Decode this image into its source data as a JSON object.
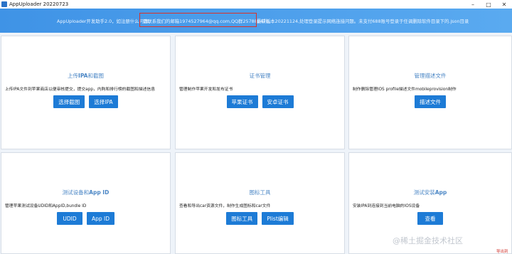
{
  "window": {
    "title": "AppUploader 20220723"
  },
  "banner": {
    "text_left": "AppUploader开发助手2.0，如注册什么问题，",
    "text_highlight": "请联系我们的邮箱1974527964@qq.com,QQ群257889476。",
    "text_right": "最新版本20221124,处理登录提示网络连接问题。未支付688账号登录于任调删除软件目录下的.json目录"
  },
  "cards": [
    {
      "title_pre": "上传",
      "title_bold": "IPA",
      "title_post": "和截图",
      "desc": "上传IPA文件到苹果商店以便审核提交，提交app，内购和排行榜的截图和描述信息",
      "buttons": [
        "选择截图",
        "选择IPA"
      ]
    },
    {
      "title_pre": "证书管理",
      "title_bold": "",
      "title_post": "",
      "desc": "管理制作苹果开发和发布证书",
      "buttons": [
        "苹果证书",
        "安卓证书"
      ]
    },
    {
      "title_pre": "管理描述文件",
      "title_bold": "",
      "title_post": "",
      "desc": "制作删除管理IOS profile描述文件mobileprovision制作",
      "buttons": [
        "描述文件"
      ]
    },
    {
      "title_pre": "测试设备和",
      "title_bold": "App ID",
      "title_post": "",
      "desc": "管理苹果测试设备UDID和AppID,bundle ID",
      "buttons": [
        "UDID",
        "App ID"
      ]
    },
    {
      "title_pre": "图标工具",
      "title_bold": "",
      "title_post": "",
      "desc": "查看和导出car资源文件，制作生成图标和car文件",
      "buttons": [
        "图标工具",
        "Plist编辑"
      ]
    },
    {
      "title_pre": "测试安装",
      "title_bold": "App",
      "title_post": "",
      "desc": "安装IPA到连接到当前电脑的IOS设备",
      "buttons": [
        "查看"
      ]
    }
  ],
  "watermark": "@稀土掘金技术社区",
  "corner_tag": "导出到"
}
